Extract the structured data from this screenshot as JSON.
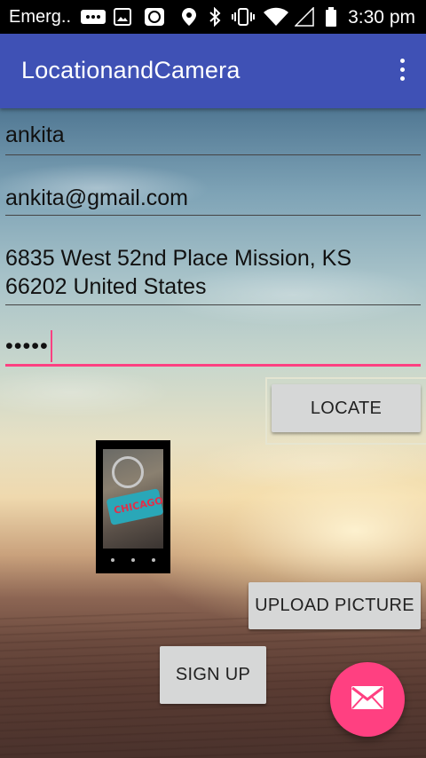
{
  "status_bar": {
    "carrier": "Emerg..",
    "time": "3:30 pm",
    "icons": [
      "message-icon",
      "image-icon",
      "sync-icon",
      "location-icon",
      "bluetooth-icon",
      "vibrate-icon",
      "wifi-icon",
      "signal-icon",
      "battery-icon"
    ]
  },
  "app_bar": {
    "title": "LocationandCamera",
    "overflow_icon": "more-vert-icon",
    "color": "#3f51b5"
  },
  "form": {
    "name": "ankita",
    "email": "ankita@gmail.com",
    "address_line1": "6835 West 52nd Place  Mission, KS",
    "address_line2": "66202 United States",
    "password_masked": "•••••"
  },
  "buttons": {
    "locate": "LOCATE",
    "upload_picture": "UPLOAD PICTURE",
    "sign_up": "SIGN UP"
  },
  "thumbnail": {
    "tag_text": "CHICAGO"
  },
  "fab": {
    "icon": "email-icon",
    "color": "#ff4081"
  },
  "accent_color": "#ff4081"
}
